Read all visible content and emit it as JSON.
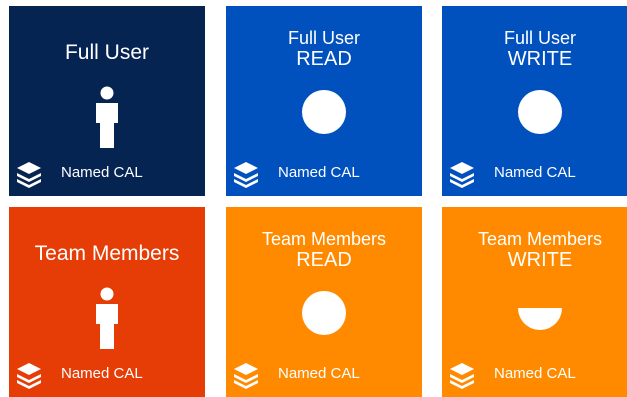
{
  "tiles": [
    {
      "title_line1": "Full User",
      "title_line2": "",
      "icon": "person-icon",
      "footer": "Named CAL",
      "color": "#062452"
    },
    {
      "title_line1": "Full User",
      "title_line2": "READ",
      "icon": "circle-icon",
      "footer": "Named CAL",
      "color": "#0050be"
    },
    {
      "title_line1": "Full User",
      "title_line2": "WRITE",
      "icon": "circle-icon",
      "footer": "Named CAL",
      "color": "#0050be"
    },
    {
      "title_line1": "Team Members",
      "title_line2": "",
      "icon": "person-icon",
      "footer": "Named CAL",
      "color": "#e63c05"
    },
    {
      "title_line1": "Team Members",
      "title_line2": "READ",
      "icon": "circle-icon",
      "footer": "Named CAL",
      "color": "#ff8a00"
    },
    {
      "title_line1": "Team Members",
      "title_line2": "WRITE",
      "icon": "half-circle-icon",
      "footer": "Named CAL",
      "color": "#ff8a00"
    }
  ],
  "footer_icon": "layers-icon"
}
